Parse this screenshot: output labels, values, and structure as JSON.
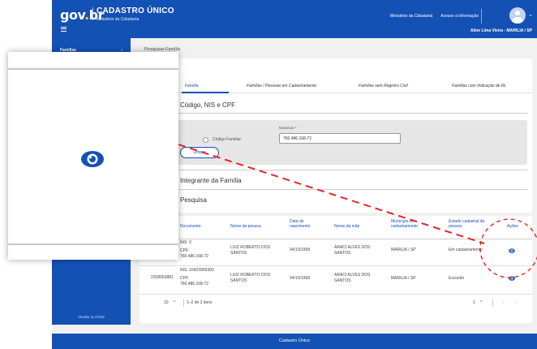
{
  "header": {
    "logo_text": "gov",
    "logo_dot": ".",
    "logo_suffix": "br",
    "system_name": "CADASTRO ÚNICO",
    "system_subtitle": "Ministério da Cidadania",
    "links": [
      "Ministério da Cidadania",
      "Acesso à informação"
    ],
    "user_name": "Aline Lima Vieira - MARILIA / SP"
  },
  "sidebar": {
    "items": [
      {
        "label": "Famílias"
      }
    ],
    "version": "Versão 11.0-b22"
  },
  "breadcrumb": "Pesquisar Família",
  "tabs": [
    {
      "label": "Família"
    },
    {
      "label": "Famílias / Pessoas em Cadastramento"
    },
    {
      "label": "Famílias sem Registro Civil"
    },
    {
      "label": "Famílias com Indicação de RL"
    }
  ],
  "search_section": {
    "title": "Código, NIS e CPF",
    "radio_label": "Código Familiar",
    "number_label": "Números *",
    "number_value": "760.486.168-72",
    "clear_label": "Limpar"
  },
  "integrante_title": "Integrante da Família",
  "results_title": "Pesquisa",
  "table": {
    "columns": [
      "Documento",
      "Nome da pessoa",
      "Data de nascimento",
      "Nome da mãe",
      "Município de cadastramento",
      "Estado cadastral da pessoa",
      "Ações"
    ],
    "rows": [
      {
        "codigo": "",
        "nis": "NIS: 0",
        "cpf_label": "CPF:",
        "cpf": "760.486.168-72",
        "nome": "LUIZ ROBERTO DOS SANTOS",
        "nascimento": "04/10/1958",
        "mae": "ARACI ALVES DOS SANTOS",
        "municipio": "MARILIA / SP",
        "estado": "Em cadastramento"
      },
      {
        "codigo": "2208953881",
        "nis": "NIS: 10423999300",
        "cpf_label": "CPF:",
        "cpf": "760.486.168-72",
        "nome": "LUIZ ROBERTO DOS SANTOS",
        "nascimento": "04/10/1958",
        "mae": "ARACI ALVES DOS SANTOS",
        "municipio": "MARILIA / SP",
        "estado": "Excluído"
      }
    ],
    "page_size": "10",
    "range_text": "1–2 de 2 itens",
    "page": "1"
  },
  "footer_text": "Cadastro Único",
  "colors": {
    "brand_blue": "#1351b4",
    "logo_yellow": "#ffcd07",
    "annotation_red": "#e8232b"
  }
}
